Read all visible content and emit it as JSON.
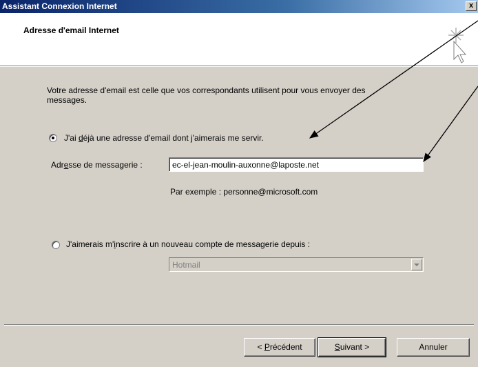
{
  "window": {
    "title": "Assistant Connexion Internet",
    "close_label": "x"
  },
  "header": {
    "title": "Adresse d'email Internet",
    "icon": "wizard-cursor-sparkle-icon"
  },
  "content": {
    "intro_line1": "Votre adresse d'email est celle que vos correspondants utilisent pour vous envoyer des",
    "intro_line2": "messages.",
    "option_existing": {
      "label_before": "J'ai ",
      "label_mnemonic": "d",
      "label_after": "éjà une adresse d'email dont j'aimerais me servir.",
      "selected": true
    },
    "email_field": {
      "label_before": "Adr",
      "label_mnemonic": "e",
      "label_after": "sse de messagerie :",
      "value": "ec-el-jean-moulin-auxonne@laposte.net"
    },
    "example_text": "Par exemple : personne@microsoft.com",
    "option_new": {
      "label_before": "J'aimerais m'",
      "label_mnemonic": "i",
      "label_after": "nscrire à un nouveau compte de messagerie depuis :",
      "selected": false
    },
    "provider_select": {
      "value": "Hotmail"
    }
  },
  "buttons": {
    "back": {
      "prefix": "< ",
      "mnemonic": "P",
      "rest": "récédent"
    },
    "next": {
      "mnemonic": "S",
      "rest": "uivant",
      "suffix": " >"
    },
    "cancel": {
      "label": "Annuler"
    }
  },
  "colors": {
    "dialog_bg": "#d4d0c8",
    "titlebar_start": "#0a246a",
    "titlebar_end": "#a6caf0"
  }
}
